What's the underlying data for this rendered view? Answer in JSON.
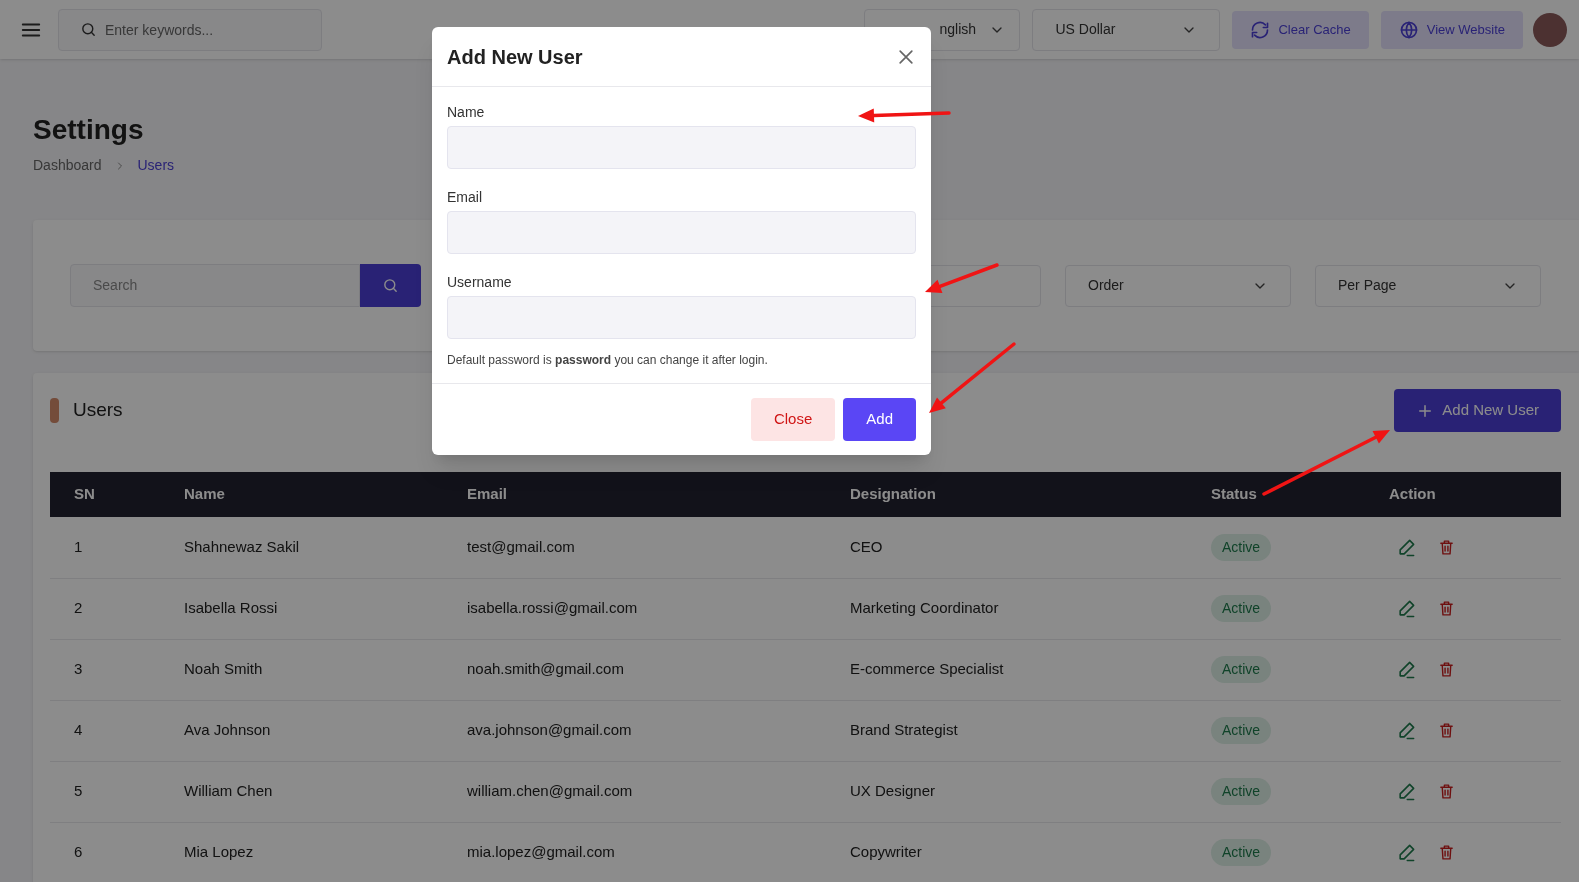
{
  "topbar": {
    "search": {
      "placeholder": "Enter keywords..."
    },
    "language": "nglish",
    "currency": "US Dollar",
    "buttons": [
      "Clear Cache",
      "View Website"
    ]
  },
  "page": {
    "title": "Settings",
    "breadcrumb": [
      {
        "label": "Dashboard",
        "selected": false
      },
      {
        "label": "Users",
        "selected": true
      }
    ]
  },
  "filters": {
    "search": {
      "placeholder": "Search"
    },
    "dropdowns": [
      "Order",
      "Per Page"
    ]
  },
  "users": {
    "title": "Users",
    "add_button": "Add New User",
    "columns": [
      "SN",
      "Name",
      "Email",
      "Designation",
      "Status",
      "Action"
    ],
    "rows": [
      {
        "sn": "1",
        "name": "Shahnewaz Sakil",
        "email": "test@gmail.com",
        "designation": "CEO",
        "status": "Active"
      },
      {
        "sn": "2",
        "name": "Isabella Rossi",
        "email": "isabella.rossi@gmail.com",
        "designation": "Marketing Coordinator",
        "status": "Active"
      },
      {
        "sn": "3",
        "name": "Noah Smith",
        "email": "noah.smith@gmail.com",
        "designation": "E-commerce Specialist",
        "status": "Active"
      },
      {
        "sn": "4",
        "name": "Ava Johnson",
        "email": "ava.johnson@gmail.com",
        "designation": "Brand Strategist",
        "status": "Active"
      },
      {
        "sn": "5",
        "name": "William Chen",
        "email": "william.chen@gmail.com",
        "designation": "UX Designer",
        "status": "Active"
      },
      {
        "sn": "6",
        "name": "Mia Lopez",
        "email": "mia.lopez@gmail.com",
        "designation": "Copywriter",
        "status": "Active"
      }
    ]
  },
  "modal": {
    "title": "Add New User",
    "fields": [
      {
        "label": "Name"
      },
      {
        "label": "Email"
      },
      {
        "label": "Username"
      }
    ],
    "note": "Default password is **password** you can change it after login.",
    "buttons": [
      {
        "kind": "cancel",
        "label": "Close"
      },
      {
        "kind": "primary",
        "label": "Add"
      }
    ]
  }
}
